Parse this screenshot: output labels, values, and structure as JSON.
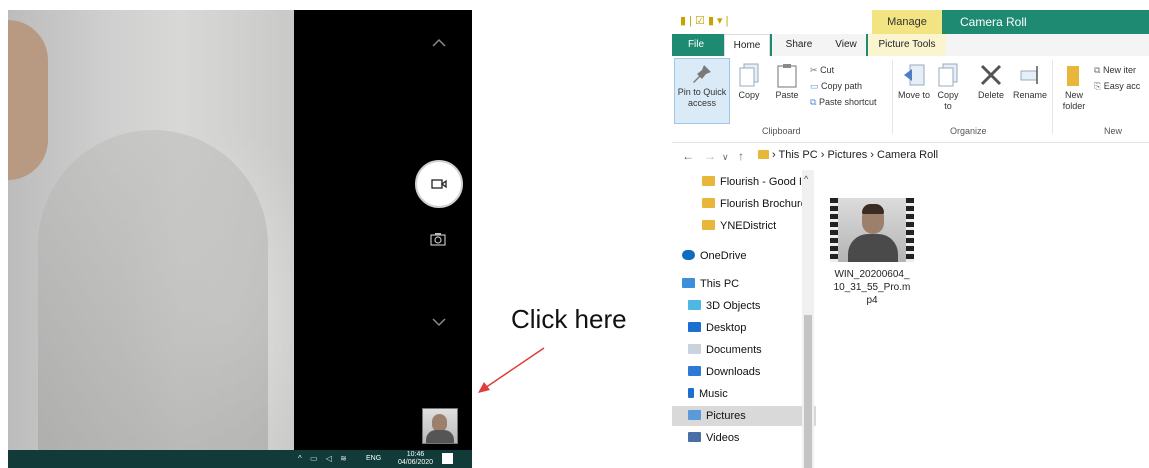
{
  "camera": {
    "taskbar": {
      "language": "ENG",
      "time": "10:46",
      "date": "04/06/2020"
    },
    "icons": {
      "scroll_up": "chevron-up-icon",
      "scroll_down": "chevron-down-icon",
      "video_mode": "video-camera-icon",
      "photo_mode": "camera-icon"
    }
  },
  "annotation": {
    "text": "Click here",
    "arrow_color": "#e03c3c"
  },
  "explorer": {
    "contextual_tab": "Manage",
    "window_title": "Camera Roll",
    "tabs": [
      "File",
      "Home",
      "Share",
      "View",
      "Picture Tools"
    ],
    "ribbon": {
      "pin": "Pin to Quick access",
      "copy": "Copy",
      "paste": "Paste",
      "cut": "Cut",
      "copy_path": "Copy path",
      "paste_shortcut": "Paste shortcut",
      "clipboard_group": "Clipboard",
      "move_to": "Move to",
      "copy_to": "Copy to",
      "delete": "Delete",
      "rename": "Rename",
      "organize_group": "Organize",
      "new_folder": "New folder",
      "new_item": "New iter",
      "easy_access": "Easy acc",
      "new_group": "New"
    },
    "address": {
      "crumbs": [
        "This PC",
        "Pictures",
        "Camera Roll"
      ]
    },
    "nav_items": [
      {
        "label": "Flourish - Good I",
        "icon": "shared-folder-icon"
      },
      {
        "label": "Flourish Brochure",
        "icon": "shared-folder-icon"
      },
      {
        "label": "YNEDistrict",
        "icon": "shared-folder-icon"
      },
      {
        "label": "OneDrive",
        "icon": "onedrive-icon"
      },
      {
        "label": "This PC",
        "icon": "this-pc-icon"
      },
      {
        "label": "3D Objects",
        "icon": "3d-objects-icon"
      },
      {
        "label": "Desktop",
        "icon": "desktop-icon"
      },
      {
        "label": "Documents",
        "icon": "documents-icon"
      },
      {
        "label": "Downloads",
        "icon": "downloads-icon"
      },
      {
        "label": "Music",
        "icon": "music-icon"
      },
      {
        "label": "Pictures",
        "icon": "pictures-icon"
      },
      {
        "label": "Videos",
        "icon": "videos-icon"
      }
    ],
    "file": {
      "name": "WIN_20200604_10_31_55_Pro.mp4"
    },
    "colors": {
      "accent": "#1f8a72",
      "contextual": "#f2e483"
    }
  }
}
